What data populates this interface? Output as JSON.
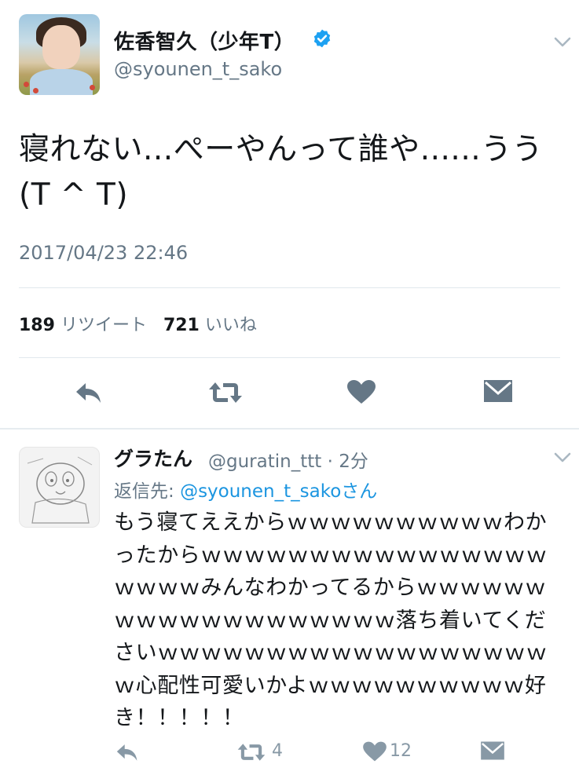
{
  "tweet": {
    "display_name": "佐香智久（少年T）",
    "handle": "@syounen_t_sako",
    "text_line1": "寝れない...ぺーやんって誰や......うう",
    "text_line2": "(T ^ T)",
    "timestamp": "2017/04/23 22:46",
    "retweet_count": "189",
    "retweet_label": "リツイート",
    "like_count": "721",
    "like_label": "いいね"
  },
  "reply": {
    "display_name": "グラたん",
    "handle_time": "@guratin_ttt · 2分",
    "reply_prefix": "返信先: ",
    "reply_to": "@syounen_t_sako",
    "reply_suffix": "さん",
    "text": "もう寝てええからｗｗｗｗｗｗｗｗｗｗわかったからｗｗｗｗｗｗｗｗｗｗｗｗｗｗｗｗｗｗｗｗみんなわかってるからｗｗｗｗｗｗｗｗｗｗｗｗｗｗｗｗｗｗｗ落ち着いてくださいｗｗｗｗｗｗｗｗｗｗｗｗｗｗｗｗｗｗｗ心配性可愛いかよｗｗｗｗｗｗｗｗｗｗ好き！！！！！",
    "retweet_count": "4",
    "like_count": "12"
  },
  "colors": {
    "verified": "#1da1f2",
    "icon_gray": "#657786",
    "link": "#1b95e0"
  },
  "icons": [
    "chevron-down-icon",
    "verified-badge-icon",
    "reply-icon",
    "retweet-icon",
    "like-heart-icon",
    "direct-message-icon"
  ]
}
